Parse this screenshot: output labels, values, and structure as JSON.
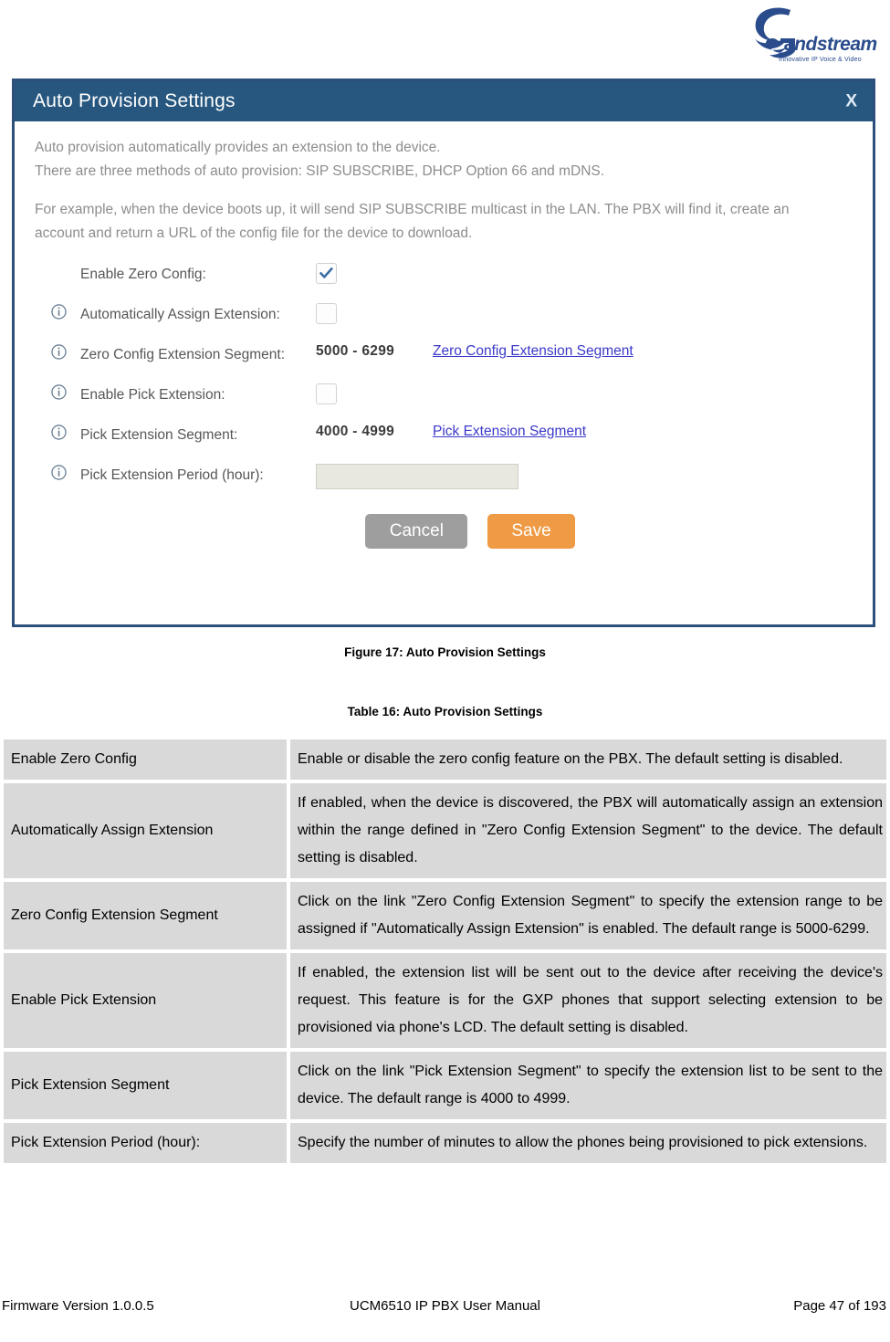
{
  "brand": {
    "name": "Grandstream",
    "tagline": "Innovative IP Voice & Video",
    "logo_color": "#2b4c8c"
  },
  "dialog": {
    "title": "Auto Provision Settings",
    "close_label": "X",
    "titlebar_color": "#27577f",
    "border_color": "#2c4f7c",
    "intro": {
      "line1": "Auto provision automatically provides an extension to the device.",
      "line2": "There are three methods of auto provision: SIP SUBSCRIBE, DHCP Option 66 and mDNS.",
      "line3": "For example, when the device boots up, it will send SIP SUBSCRIBE multicast in the LAN. The PBX will find it, create an",
      "line4": "account and return a URL of the config file for the device to download."
    },
    "fields": [
      {
        "label": "Enable Zero Config:",
        "has_info": false,
        "control": "checkbox",
        "checked": true
      },
      {
        "label": "Automatically Assign Extension:",
        "has_info": true,
        "control": "checkbox",
        "checked": false
      },
      {
        "label": "Zero Config Extension Segment:",
        "has_info": true,
        "control": "range-link",
        "range": "5000 - 6299",
        "link": "Zero Config Extension Segment"
      },
      {
        "label": "Enable Pick Extension:",
        "has_info": true,
        "control": "checkbox",
        "checked": false
      },
      {
        "label": "Pick Extension Segment:",
        "has_info": true,
        "control": "range-link",
        "range": "4000 - 4999",
        "link": "Pick Extension Segment"
      },
      {
        "label": "Pick Extension Period (hour):",
        "has_info": true,
        "control": "text-input",
        "value": "",
        "placeholder": ""
      }
    ],
    "buttons": {
      "cancel": "Cancel",
      "save": "Save",
      "cancel_color": "#9e9e9e",
      "save_color": "#ef9a44"
    }
  },
  "captions": {
    "figure": "Figure 17: Auto Provision Settings",
    "table": "Table 16: Auto Provision Settings"
  },
  "table": {
    "rows": [
      {
        "name": "Enable Zero Config",
        "description": "Enable or disable the zero config feature on the PBX. The default setting is disabled."
      },
      {
        "name": "Automatically Assign Extension",
        "description": "If enabled, when the device is discovered, the PBX will automatically assign an extension within the range defined in \"Zero Config Extension Segment\" to the device. The default setting is disabled."
      },
      {
        "name": "Zero Config Extension Segment",
        "description": "Click on the link \"Zero Config Extension Segment\" to specify the extension range to be assigned if \"Automatically Assign Extension\" is enabled. The default range is 5000-6299."
      },
      {
        "name": "Enable Pick Extension",
        "description": "If enabled, the extension list will be sent out to the device after receiving the device's request. This feature is for the GXP   phones that support selecting extension to be provisioned via phone's LCD. The default setting is disabled."
      },
      {
        "name": "Pick Extension Segment",
        "description": "Click on the link \"Pick Extension Segment\" to specify the extension list to be sent to the device. The default range is 4000 to 4999."
      },
      {
        "name": "Pick Extension Period (hour):",
        "description": "Specify the number of minutes to allow the phones being provisioned to pick extensions."
      }
    ]
  },
  "footer": {
    "left": "Firmware Version 1.0.0.5",
    "center": "UCM6510 IP PBX User Manual",
    "right": "Page 47 of 193"
  }
}
